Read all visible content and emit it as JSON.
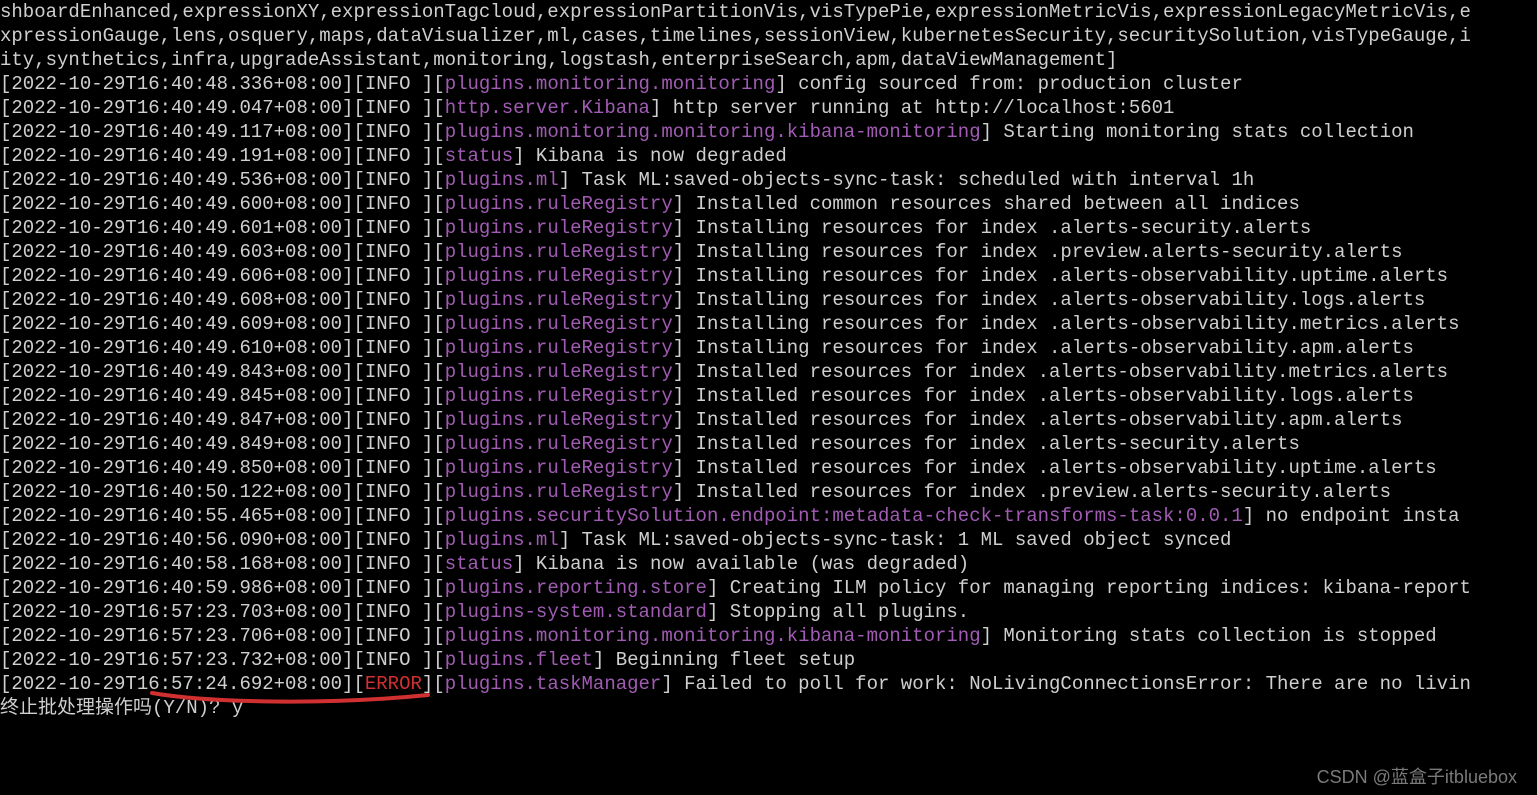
{
  "header_lines": [
    "shboardEnhanced,expressionXY,expressionTagcloud,expressionPartitionVis,visTypePie,expressionMetricVis,expressionLegacyMetricVis,e",
    "xpressionGauge,lens,osquery,maps,dataVisualizer,ml,cases,timelines,sessionView,kubernetesSecurity,securitySolution,visTypeGauge,i",
    "ity,synthetics,infra,upgradeAssistant,monitoring,logstash,enterpriseSearch,apm,dataViewManagement]"
  ],
  "log_lines": [
    {
      "ts": "[2022-10-29T16:40:48.336+08:00]",
      "lvl": "INFO ",
      "ctx": "plugins.monitoring.monitoring",
      "msg": " config sourced from: production cluster"
    },
    {
      "ts": "[2022-10-29T16:40:49.047+08:00]",
      "lvl": "INFO ",
      "ctx": "http.server.Kibana",
      "msg": " http server running at http://localhost:5601"
    },
    {
      "ts": "[2022-10-29T16:40:49.117+08:00]",
      "lvl": "INFO ",
      "ctx": "plugins.monitoring.monitoring.kibana-monitoring",
      "msg": " Starting monitoring stats collection"
    },
    {
      "ts": "[2022-10-29T16:40:49.191+08:00]",
      "lvl": "INFO ",
      "ctx": "status",
      "msg": " Kibana is now degraded"
    },
    {
      "ts": "[2022-10-29T16:40:49.536+08:00]",
      "lvl": "INFO ",
      "ctx": "plugins.ml",
      "msg": " Task ML:saved-objects-sync-task: scheduled with interval 1h"
    },
    {
      "ts": "[2022-10-29T16:40:49.600+08:00]",
      "lvl": "INFO ",
      "ctx": "plugins.ruleRegistry",
      "msg": " Installed common resources shared between all indices"
    },
    {
      "ts": "[2022-10-29T16:40:49.601+08:00]",
      "lvl": "INFO ",
      "ctx": "plugins.ruleRegistry",
      "msg": " Installing resources for index .alerts-security.alerts"
    },
    {
      "ts": "[2022-10-29T16:40:49.603+08:00]",
      "lvl": "INFO ",
      "ctx": "plugins.ruleRegistry",
      "msg": " Installing resources for index .preview.alerts-security.alerts"
    },
    {
      "ts": "[2022-10-29T16:40:49.606+08:00]",
      "lvl": "INFO ",
      "ctx": "plugins.ruleRegistry",
      "msg": " Installing resources for index .alerts-observability.uptime.alerts"
    },
    {
      "ts": "[2022-10-29T16:40:49.608+08:00]",
      "lvl": "INFO ",
      "ctx": "plugins.ruleRegistry",
      "msg": " Installing resources for index .alerts-observability.logs.alerts"
    },
    {
      "ts": "[2022-10-29T16:40:49.609+08:00]",
      "lvl": "INFO ",
      "ctx": "plugins.ruleRegistry",
      "msg": " Installing resources for index .alerts-observability.metrics.alerts"
    },
    {
      "ts": "[2022-10-29T16:40:49.610+08:00]",
      "lvl": "INFO ",
      "ctx": "plugins.ruleRegistry",
      "msg": " Installing resources for index .alerts-observability.apm.alerts"
    },
    {
      "ts": "[2022-10-29T16:40:49.843+08:00]",
      "lvl": "INFO ",
      "ctx": "plugins.ruleRegistry",
      "msg": " Installed resources for index .alerts-observability.metrics.alerts"
    },
    {
      "ts": "[2022-10-29T16:40:49.845+08:00]",
      "lvl": "INFO ",
      "ctx": "plugins.ruleRegistry",
      "msg": " Installed resources for index .alerts-observability.logs.alerts"
    },
    {
      "ts": "[2022-10-29T16:40:49.847+08:00]",
      "lvl": "INFO ",
      "ctx": "plugins.ruleRegistry",
      "msg": " Installed resources for index .alerts-observability.apm.alerts"
    },
    {
      "ts": "[2022-10-29T16:40:49.849+08:00]",
      "lvl": "INFO ",
      "ctx": "plugins.ruleRegistry",
      "msg": " Installed resources for index .alerts-security.alerts"
    },
    {
      "ts": "[2022-10-29T16:40:49.850+08:00]",
      "lvl": "INFO ",
      "ctx": "plugins.ruleRegistry",
      "msg": " Installed resources for index .alerts-observability.uptime.alerts"
    },
    {
      "ts": "[2022-10-29T16:40:50.122+08:00]",
      "lvl": "INFO ",
      "ctx": "plugins.ruleRegistry",
      "msg": " Installed resources for index .preview.alerts-security.alerts"
    },
    {
      "ts": "[2022-10-29T16:40:55.465+08:00]",
      "lvl": "INFO ",
      "ctx": "plugins.securitySolution.endpoint:metadata-check-transforms-task:0.0.1",
      "msg": " no endpoint insta"
    },
    {
      "ts": "[2022-10-29T16:40:56.090+08:00]",
      "lvl": "INFO ",
      "ctx": "plugins.ml",
      "msg": " Task ML:saved-objects-sync-task: 1 ML saved object synced"
    },
    {
      "ts": "[2022-10-29T16:40:58.168+08:00]",
      "lvl": "INFO ",
      "ctx": "status",
      "msg": " Kibana is now available (was degraded)"
    },
    {
      "ts": "[2022-10-29T16:40:59.986+08:00]",
      "lvl": "INFO ",
      "ctx": "plugins.reporting.store",
      "msg": " Creating ILM policy for managing reporting indices: kibana-report"
    },
    {
      "ts": "[2022-10-29T16:57:23.703+08:00]",
      "lvl": "INFO ",
      "ctx": "plugins-system.standard",
      "msg": " Stopping all plugins."
    },
    {
      "ts": "[2022-10-29T16:57:23.706+08:00]",
      "lvl": "INFO ",
      "ctx": "plugins.monitoring.monitoring.kibana-monitoring",
      "msg": " Monitoring stats collection is stopped"
    },
    {
      "ts": "[2022-10-29T16:57:23.732+08:00]",
      "lvl": "INFO ",
      "ctx": "plugins.fleet",
      "msg": " Beginning fleet setup"
    },
    {
      "ts": "[2022-10-29T16:57:24.692+08:00]",
      "lvl": "ERROR",
      "ctx": "plugins.taskManager",
      "msg": " Failed to poll for work: NoLivingConnectionsError: There are no livin"
    }
  ],
  "prompt_line": "终止批处理操作吗(Y/N)? y",
  "watermark": "CSDN @蓝盒子itbluebox"
}
